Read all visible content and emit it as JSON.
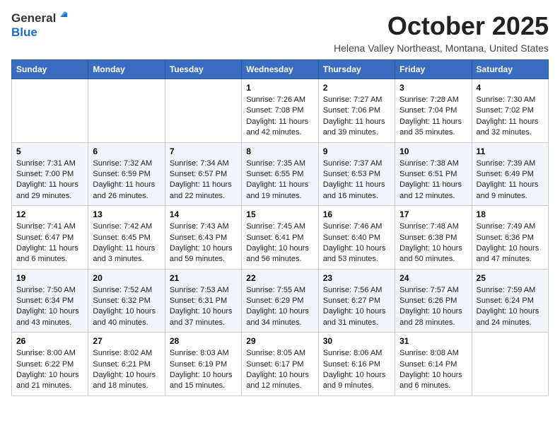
{
  "header": {
    "logo_general": "General",
    "logo_blue": "Blue",
    "month": "October 2025",
    "location": "Helena Valley Northeast, Montana, United States"
  },
  "days_of_week": [
    "Sunday",
    "Monday",
    "Tuesday",
    "Wednesday",
    "Thursday",
    "Friday",
    "Saturday"
  ],
  "weeks": [
    [
      {
        "day": "",
        "sunrise": "",
        "sunset": "",
        "daylight": ""
      },
      {
        "day": "",
        "sunrise": "",
        "sunset": "",
        "daylight": ""
      },
      {
        "day": "",
        "sunrise": "",
        "sunset": "",
        "daylight": ""
      },
      {
        "day": "1",
        "sunrise": "Sunrise: 7:26 AM",
        "sunset": "Sunset: 7:08 PM",
        "daylight": "Daylight: 11 hours and 42 minutes."
      },
      {
        "day": "2",
        "sunrise": "Sunrise: 7:27 AM",
        "sunset": "Sunset: 7:06 PM",
        "daylight": "Daylight: 11 hours and 39 minutes."
      },
      {
        "day": "3",
        "sunrise": "Sunrise: 7:28 AM",
        "sunset": "Sunset: 7:04 PM",
        "daylight": "Daylight: 11 hours and 35 minutes."
      },
      {
        "day": "4",
        "sunrise": "Sunrise: 7:30 AM",
        "sunset": "Sunset: 7:02 PM",
        "daylight": "Daylight: 11 hours and 32 minutes."
      }
    ],
    [
      {
        "day": "5",
        "sunrise": "Sunrise: 7:31 AM",
        "sunset": "Sunset: 7:00 PM",
        "daylight": "Daylight: 11 hours and 29 minutes."
      },
      {
        "day": "6",
        "sunrise": "Sunrise: 7:32 AM",
        "sunset": "Sunset: 6:59 PM",
        "daylight": "Daylight: 11 hours and 26 minutes."
      },
      {
        "day": "7",
        "sunrise": "Sunrise: 7:34 AM",
        "sunset": "Sunset: 6:57 PM",
        "daylight": "Daylight: 11 hours and 22 minutes."
      },
      {
        "day": "8",
        "sunrise": "Sunrise: 7:35 AM",
        "sunset": "Sunset: 6:55 PM",
        "daylight": "Daylight: 11 hours and 19 minutes."
      },
      {
        "day": "9",
        "sunrise": "Sunrise: 7:37 AM",
        "sunset": "Sunset: 6:53 PM",
        "daylight": "Daylight: 11 hours and 16 minutes."
      },
      {
        "day": "10",
        "sunrise": "Sunrise: 7:38 AM",
        "sunset": "Sunset: 6:51 PM",
        "daylight": "Daylight: 11 hours and 12 minutes."
      },
      {
        "day": "11",
        "sunrise": "Sunrise: 7:39 AM",
        "sunset": "Sunset: 6:49 PM",
        "daylight": "Daylight: 11 hours and 9 minutes."
      }
    ],
    [
      {
        "day": "12",
        "sunrise": "Sunrise: 7:41 AM",
        "sunset": "Sunset: 6:47 PM",
        "daylight": "Daylight: 11 hours and 6 minutes."
      },
      {
        "day": "13",
        "sunrise": "Sunrise: 7:42 AM",
        "sunset": "Sunset: 6:45 PM",
        "daylight": "Daylight: 11 hours and 3 minutes."
      },
      {
        "day": "14",
        "sunrise": "Sunrise: 7:43 AM",
        "sunset": "Sunset: 6:43 PM",
        "daylight": "Daylight: 10 hours and 59 minutes."
      },
      {
        "day": "15",
        "sunrise": "Sunrise: 7:45 AM",
        "sunset": "Sunset: 6:41 PM",
        "daylight": "Daylight: 10 hours and 56 minutes."
      },
      {
        "day": "16",
        "sunrise": "Sunrise: 7:46 AM",
        "sunset": "Sunset: 6:40 PM",
        "daylight": "Daylight: 10 hours and 53 minutes."
      },
      {
        "day": "17",
        "sunrise": "Sunrise: 7:48 AM",
        "sunset": "Sunset: 6:38 PM",
        "daylight": "Daylight: 10 hours and 50 minutes."
      },
      {
        "day": "18",
        "sunrise": "Sunrise: 7:49 AM",
        "sunset": "Sunset: 6:36 PM",
        "daylight": "Daylight: 10 hours and 47 minutes."
      }
    ],
    [
      {
        "day": "19",
        "sunrise": "Sunrise: 7:50 AM",
        "sunset": "Sunset: 6:34 PM",
        "daylight": "Daylight: 10 hours and 43 minutes."
      },
      {
        "day": "20",
        "sunrise": "Sunrise: 7:52 AM",
        "sunset": "Sunset: 6:32 PM",
        "daylight": "Daylight: 10 hours and 40 minutes."
      },
      {
        "day": "21",
        "sunrise": "Sunrise: 7:53 AM",
        "sunset": "Sunset: 6:31 PM",
        "daylight": "Daylight: 10 hours and 37 minutes."
      },
      {
        "day": "22",
        "sunrise": "Sunrise: 7:55 AM",
        "sunset": "Sunset: 6:29 PM",
        "daylight": "Daylight: 10 hours and 34 minutes."
      },
      {
        "day": "23",
        "sunrise": "Sunrise: 7:56 AM",
        "sunset": "Sunset: 6:27 PM",
        "daylight": "Daylight: 10 hours and 31 minutes."
      },
      {
        "day": "24",
        "sunrise": "Sunrise: 7:57 AM",
        "sunset": "Sunset: 6:26 PM",
        "daylight": "Daylight: 10 hours and 28 minutes."
      },
      {
        "day": "25",
        "sunrise": "Sunrise: 7:59 AM",
        "sunset": "Sunset: 6:24 PM",
        "daylight": "Daylight: 10 hours and 24 minutes."
      }
    ],
    [
      {
        "day": "26",
        "sunrise": "Sunrise: 8:00 AM",
        "sunset": "Sunset: 6:22 PM",
        "daylight": "Daylight: 10 hours and 21 minutes."
      },
      {
        "day": "27",
        "sunrise": "Sunrise: 8:02 AM",
        "sunset": "Sunset: 6:21 PM",
        "daylight": "Daylight: 10 hours and 18 minutes."
      },
      {
        "day": "28",
        "sunrise": "Sunrise: 8:03 AM",
        "sunset": "Sunset: 6:19 PM",
        "daylight": "Daylight: 10 hours and 15 minutes."
      },
      {
        "day": "29",
        "sunrise": "Sunrise: 8:05 AM",
        "sunset": "Sunset: 6:17 PM",
        "daylight": "Daylight: 10 hours and 12 minutes."
      },
      {
        "day": "30",
        "sunrise": "Sunrise: 8:06 AM",
        "sunset": "Sunset: 6:16 PM",
        "daylight": "Daylight: 10 hours and 9 minutes."
      },
      {
        "day": "31",
        "sunrise": "Sunrise: 8:08 AM",
        "sunset": "Sunset: 6:14 PM",
        "daylight": "Daylight: 10 hours and 6 minutes."
      },
      {
        "day": "",
        "sunrise": "",
        "sunset": "",
        "daylight": ""
      }
    ]
  ]
}
